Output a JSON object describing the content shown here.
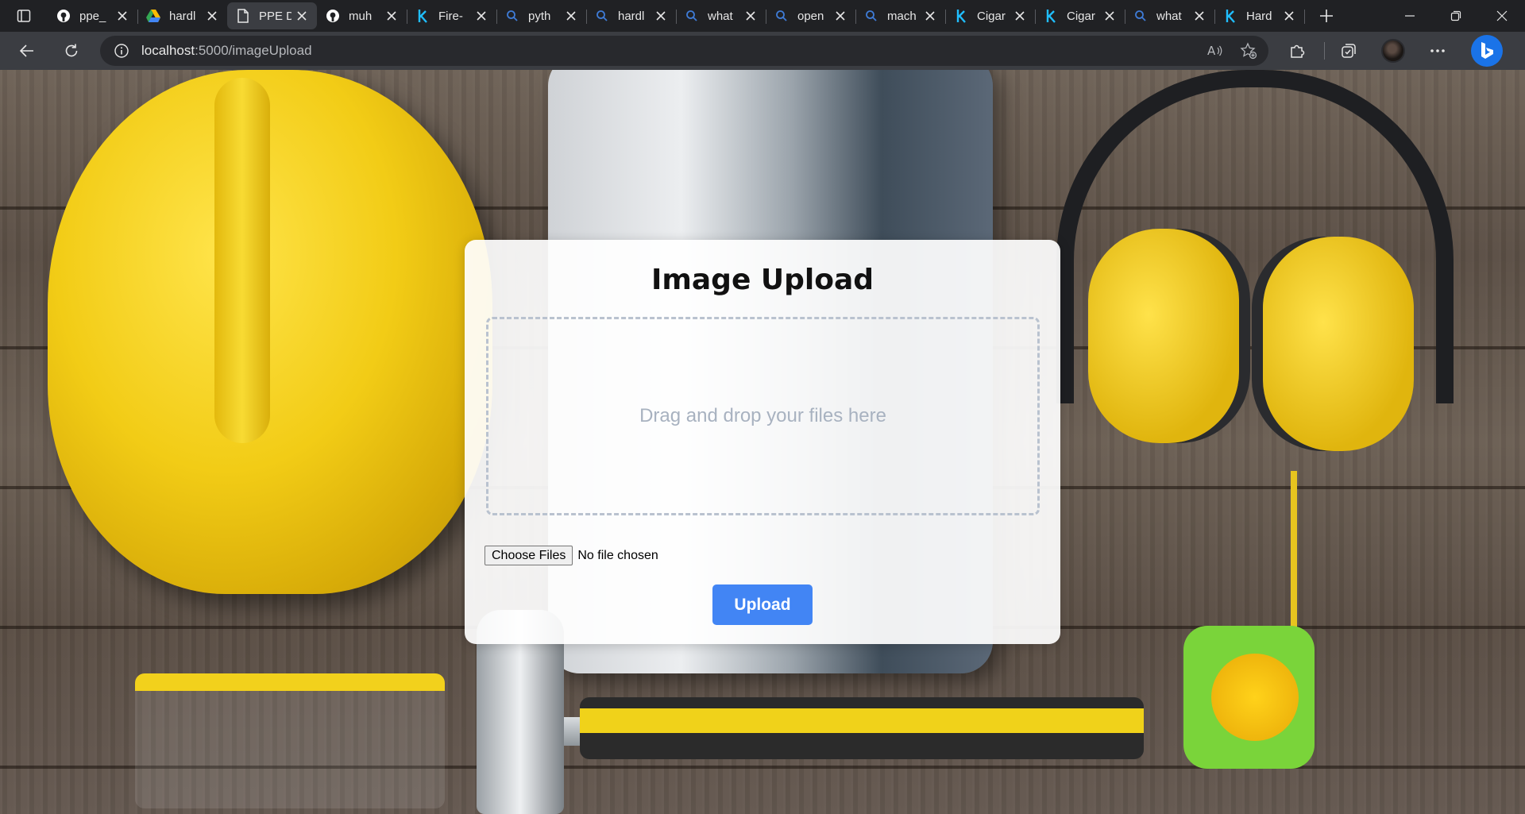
{
  "browser": {
    "tabs": [
      {
        "title": "ppe_",
        "icon": "github-icon"
      },
      {
        "title": "hardl",
        "icon": "google-drive-icon"
      },
      {
        "title": "PPE D",
        "icon": "page-icon",
        "active": true
      },
      {
        "title": "muh",
        "icon": "github-icon"
      },
      {
        "title": "Fire-",
        "icon": "kaggle-icon"
      },
      {
        "title": "pyth",
        "icon": "search-icon"
      },
      {
        "title": "hardl",
        "icon": "search-icon"
      },
      {
        "title": "what",
        "icon": "search-icon"
      },
      {
        "title": "open",
        "icon": "search-icon"
      },
      {
        "title": "mach",
        "icon": "search-icon"
      },
      {
        "title": "Cigar",
        "icon": "kaggle-icon"
      },
      {
        "title": "Cigar",
        "icon": "kaggle-icon"
      },
      {
        "title": "what",
        "icon": "search-icon"
      },
      {
        "title": "Hard",
        "icon": "kaggle-icon"
      }
    ],
    "url_host": "localhost",
    "url_path": ":5000/imageUpload",
    "accent_color": "#1a73e8"
  },
  "page": {
    "title": "Image Upload",
    "dropzone_text": "Drag and drop your files here",
    "choose_files_label": "Choose Files",
    "file_status": "No file chosen",
    "upload_label": "Upload",
    "upload_button_color": "#4285f4"
  }
}
